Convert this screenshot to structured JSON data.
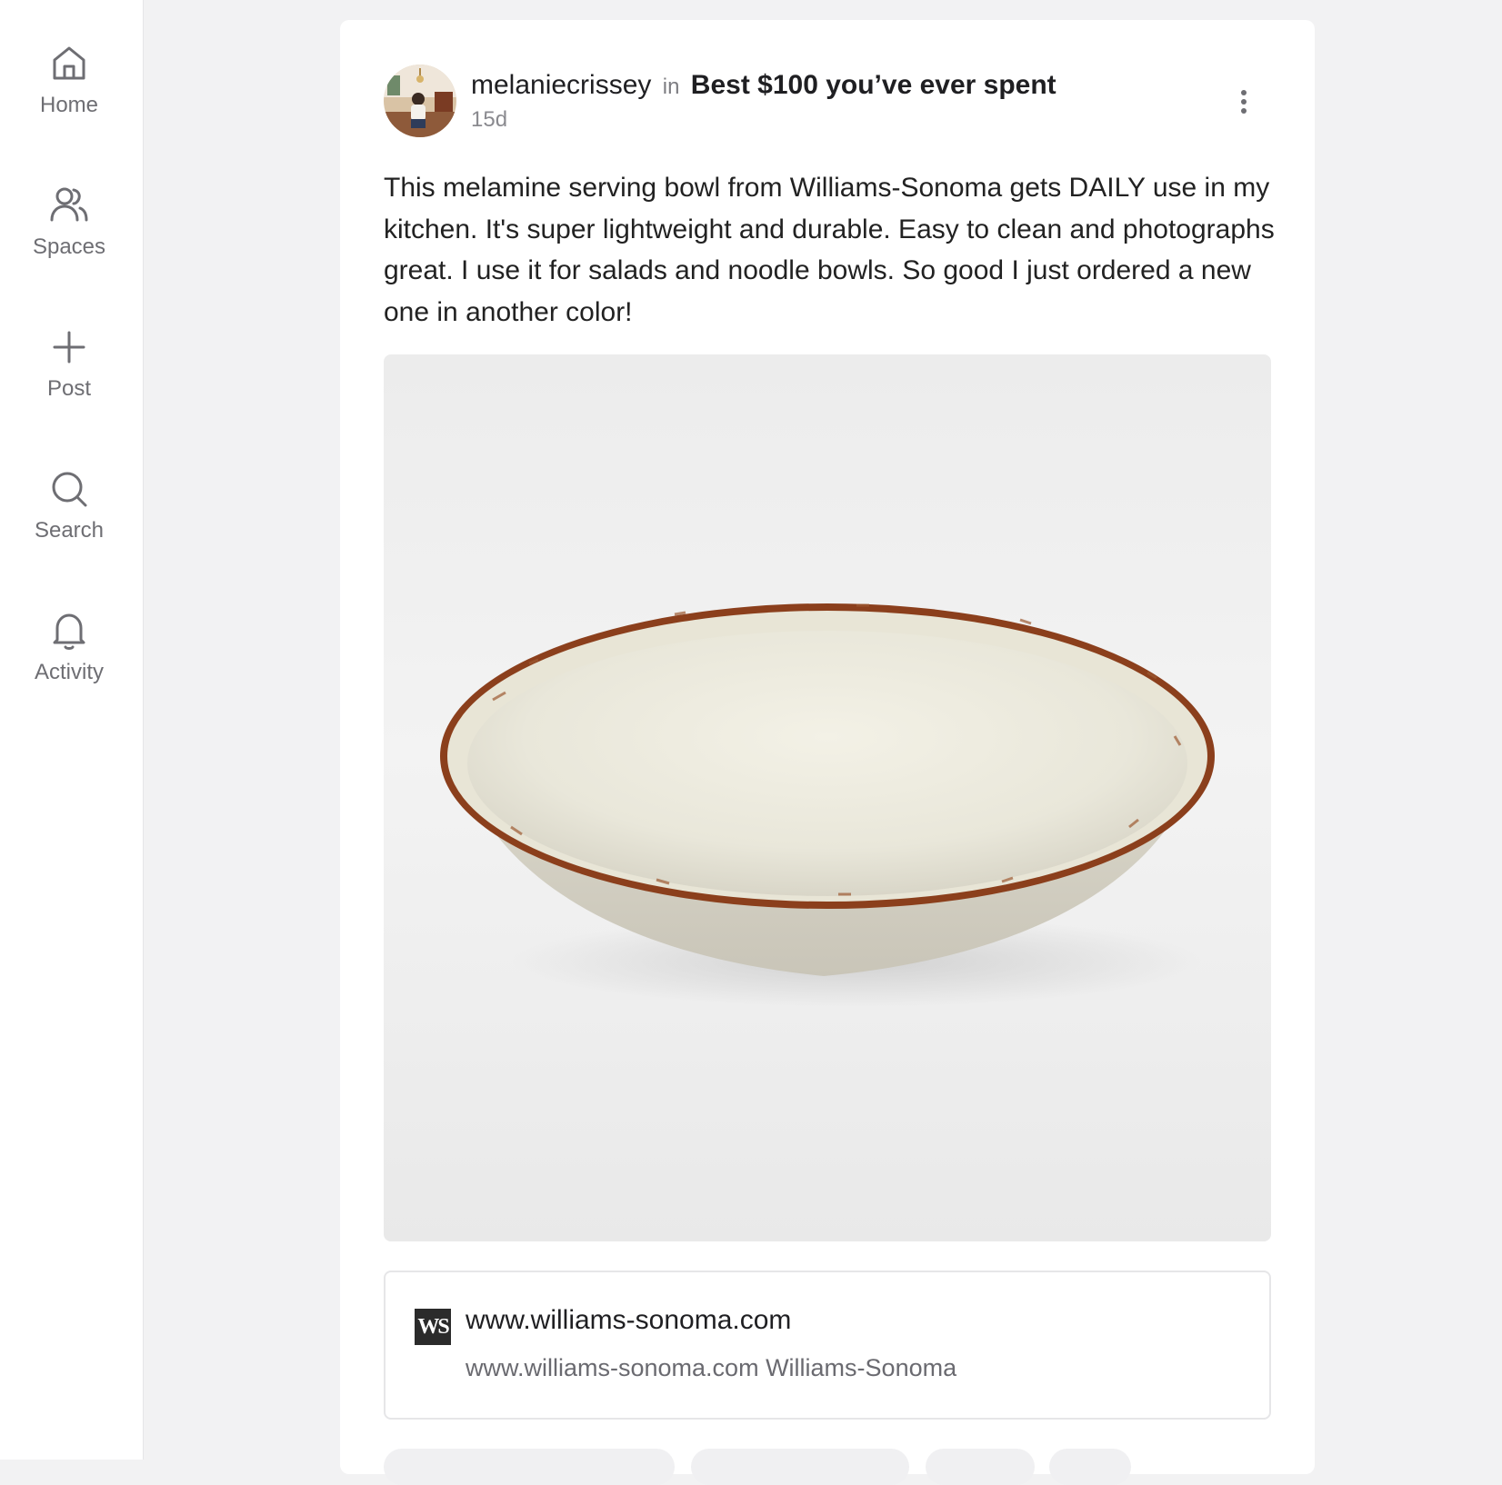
{
  "nav": {
    "home_label": "Home",
    "spaces_label": "Spaces",
    "post_label": "Post",
    "search_label": "Search",
    "activity_label": "Activity"
  },
  "post": {
    "author": "melaniecrissey",
    "in_word": "in",
    "space": "Best $100 you’ve ever spent",
    "time": "15d",
    "body": "This melamine serving bowl from Williams-Sonoma gets DAILY use in my kitchen. It's super lightweight and durable. Easy to clean and photographs great. I use it for salads and noodle bowls. So good I just ordered a new one in another color!",
    "image_icon": "serving-bowl-photo"
  },
  "link_preview": {
    "logo_text": "WS",
    "domain": "www.williams-sonoma.com",
    "description": "www.williams-sonoma.com Williams-Sonoma"
  },
  "colors": {
    "page_bg": "#f2f2f3",
    "card_bg": "#ffffff",
    "muted_text": "#6e6e73"
  }
}
